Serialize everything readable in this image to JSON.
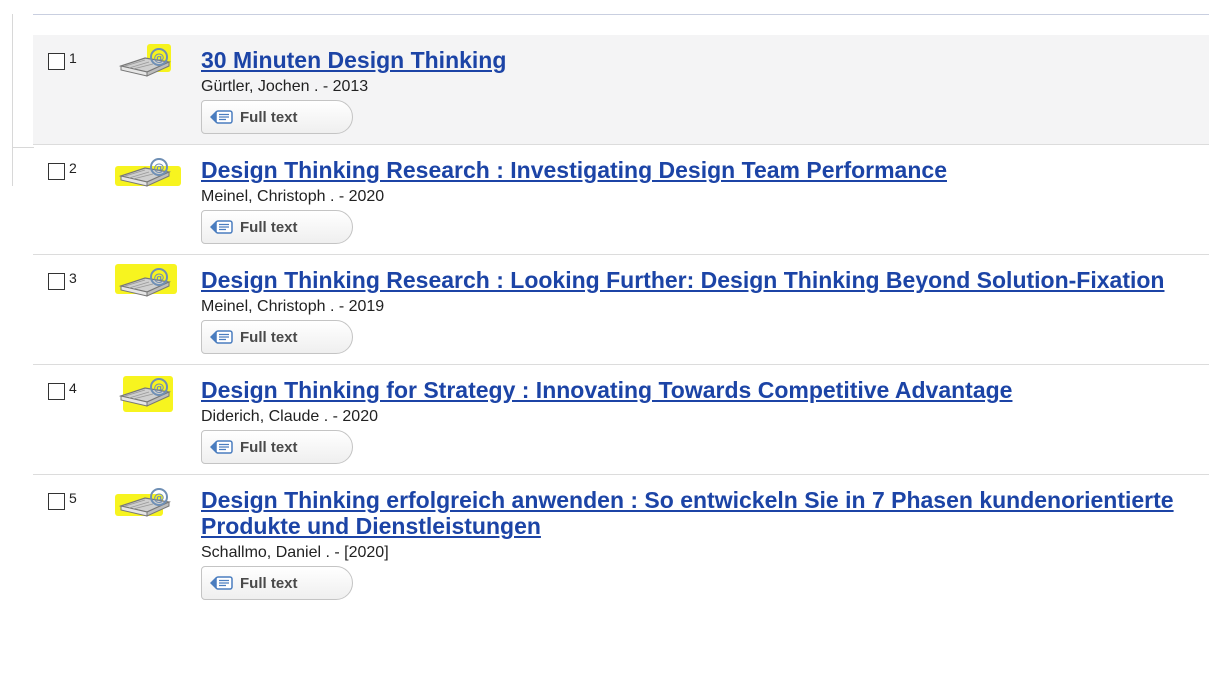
{
  "results": [
    {
      "number": "1",
      "title": "30 Minuten Design Thinking",
      "author_year": "Gürtler, Jochen . - 2013",
      "fulltext_label": "Full text"
    },
    {
      "number": "2",
      "title": "Design Thinking Research : Investigating Design Team Performance",
      "author_year": "Meinel, Christoph . - 2020",
      "fulltext_label": "Full text"
    },
    {
      "number": "3",
      "title": "Design Thinking Research : Looking Further: Design Thinking Beyond Solution-Fixation",
      "author_year": "Meinel, Christoph . - 2019",
      "fulltext_label": "Full text"
    },
    {
      "number": "4",
      "title": "Design Thinking for Strategy : Innovating Towards Competitive Advantage",
      "author_year": "Diderich, Claude . - 2020",
      "fulltext_label": "Full text"
    },
    {
      "number": "5",
      "title": "Design Thinking erfolgreich anwenden : So entwickeln Sie in 7 Phasen kundenorientierte Produkte und Dienstleistungen",
      "author_year": "Schallmo, Daniel . - [2020]",
      "fulltext_label": "Full text"
    }
  ],
  "icons": {
    "format": "ebook-at-icon",
    "fulltext": "fulltext-document-icon"
  },
  "colors": {
    "link": "#1c44a6",
    "highlight_marker": "#f6f200",
    "selected_row_bg": "#f4f4f5"
  }
}
